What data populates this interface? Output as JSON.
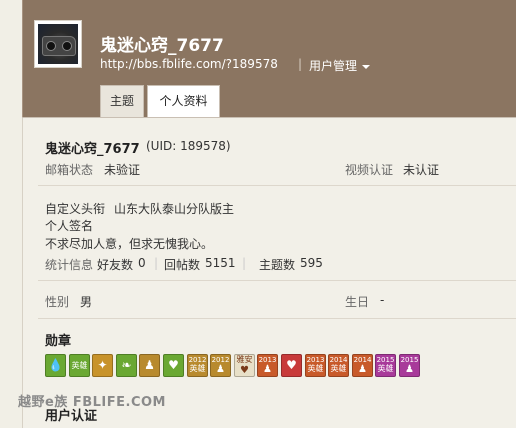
{
  "header": {
    "username": "鬼迷心窍_7677",
    "url": "http://bbs.fblife.com/?189578",
    "separator": "|",
    "user_management_label": "用户管理"
  },
  "tabs": [
    {
      "label": "主题"
    },
    {
      "label": "个人资料"
    }
  ],
  "profile": {
    "display_name": "鬼迷心窍_7677",
    "uid_text": "(UID: 189578)",
    "email_status_label": "邮箱状态",
    "email_status_value": "未验证",
    "video_auth_label": "视频认证",
    "video_auth_value": "未认证",
    "custom_title_label": "自定义头衔",
    "custom_title_value": "山东大队泰山分队版主",
    "signature_label": "个人签名",
    "signature_value": "不求尽加人意，但求无愧我心。",
    "stats_label": "统计信息",
    "friends_label": "好友数",
    "friends_count": "0",
    "replies_label": "回帖数",
    "replies_count": "5151",
    "topics_label": "主题数",
    "topics_count": "595",
    "gender_label": "性别",
    "gender_value": "男",
    "birthday_label": "生日",
    "birthday_value": "-"
  },
  "medals_section": {
    "title": "勋章",
    "medals": [
      {
        "name": "water-drop-medal",
        "year": "",
        "word": "",
        "glyph": "💧",
        "color": "#6aa832"
      },
      {
        "name": "hero-medal",
        "year": "",
        "word": "英雄",
        "glyph": "",
        "color": "#6aa832"
      },
      {
        "name": "heart-badge-medal",
        "year": "",
        "word": "",
        "glyph": "✦",
        "color": "#c8932a"
      },
      {
        "name": "leaf-medal",
        "year": "",
        "word": "",
        "glyph": "❧",
        "color": "#6aa832"
      },
      {
        "name": "team-medal",
        "year": "",
        "word": "",
        "glyph": "♟",
        "color": "#b88a2e"
      },
      {
        "name": "green-heart-medal",
        "year": "",
        "word": "",
        "glyph": "♥",
        "color": "#6aa832"
      },
      {
        "name": "2012-hero-medal",
        "year": "2012",
        "word": "英雄",
        "glyph": "",
        "color": "#b88a2e"
      },
      {
        "name": "2012-team-medal",
        "year": "2012",
        "word": "",
        "glyph": "♟",
        "color": "#b88a2e"
      },
      {
        "name": "ya-an-medal",
        "year": "",
        "word": "雅安",
        "glyph": "♥",
        "color": "#e8e0c8"
      },
      {
        "name": "2013-team-medal",
        "year": "2013",
        "word": "",
        "glyph": "♟",
        "color": "#c85a2a"
      },
      {
        "name": "red-heart-medal",
        "year": "",
        "word": "",
        "glyph": "♥",
        "color": "#c83a3a"
      },
      {
        "name": "2013-hero-medal",
        "year": "2013",
        "word": "英雄",
        "glyph": "",
        "color": "#c85a2a"
      },
      {
        "name": "2014-hero-medal",
        "year": "2014",
        "word": "英雄",
        "glyph": "",
        "color": "#c85a2a"
      },
      {
        "name": "2014-team-medal",
        "year": "2014",
        "word": "",
        "glyph": "♟",
        "color": "#c85a2a"
      },
      {
        "name": "2015-hero-medal",
        "year": "2015",
        "word": "英雄",
        "glyph": "",
        "color": "#a83a9a"
      },
      {
        "name": "2015-team-medal",
        "year": "2015",
        "word": "",
        "glyph": "♟",
        "color": "#a83a9a"
      }
    ]
  },
  "user_auth_section": {
    "title": "用户认证"
  },
  "watermark": {
    "text": "越野e族 FBLIFE.COM"
  },
  "colors": {
    "header_bg": "#8b7561",
    "page_bg": "#f1efe6",
    "active_tab_bg": "#ffffff"
  }
}
